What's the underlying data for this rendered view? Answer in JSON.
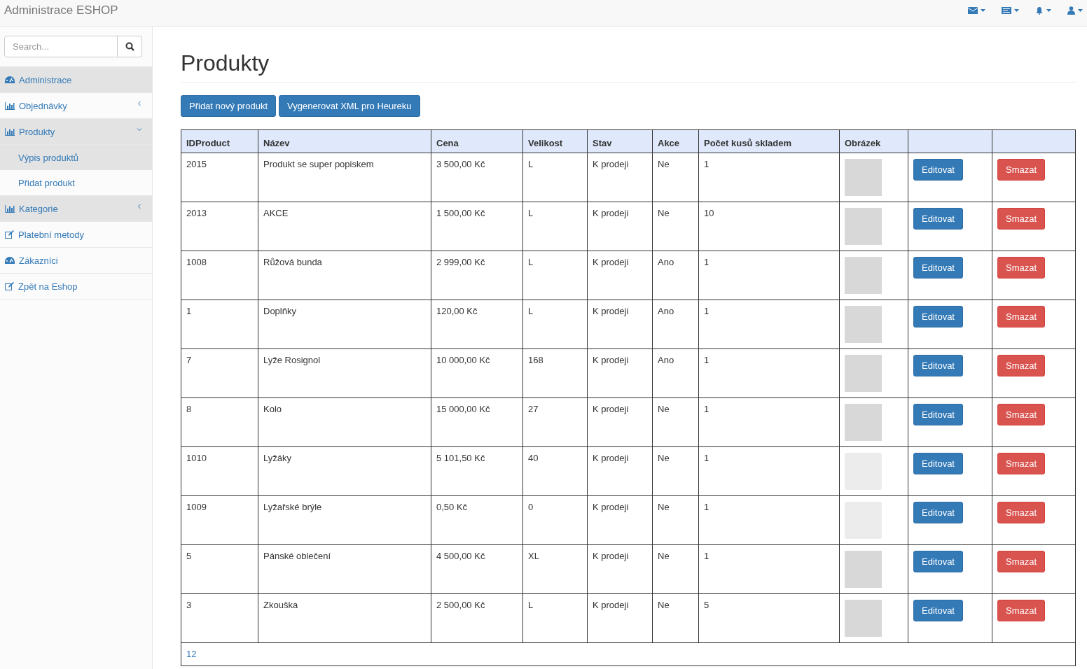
{
  "brand": "Administrace ESHOP",
  "topnav": [
    {
      "kind": "mail"
    },
    {
      "kind": "tasks"
    },
    {
      "kind": "bell"
    },
    {
      "kind": "user"
    }
  ],
  "search": {
    "placeholder": "Search..."
  },
  "sidebar": {
    "items": [
      {
        "label": "Administrace",
        "kind": "dashboard",
        "highlighted": true
      },
      {
        "label": "Objednávky",
        "kind": "chart",
        "highlighted": false,
        "expanded": false
      },
      {
        "label": "Produkty",
        "kind": "chart",
        "highlighted": true,
        "expanded": true,
        "children": [
          {
            "label": "Výpis produktů",
            "selected": true
          },
          {
            "label": "Přidat produkt",
            "selected": false
          }
        ]
      },
      {
        "label": "Kategorie",
        "kind": "chart",
        "highlighted": true,
        "expanded": false
      },
      {
        "label": "Platební metody",
        "kind": "edit",
        "highlighted": false
      },
      {
        "label": "Zákazníci",
        "kind": "dashboard",
        "highlighted": false
      },
      {
        "label": "Zpět na Eshop",
        "kind": "edit",
        "highlighted": false
      }
    ]
  },
  "page_title": "Produkty",
  "actions": [
    "Přidat nový produkt",
    "Vygenerovat XML pro Heureku"
  ],
  "table": {
    "columns": [
      "IDProduct",
      "Název",
      "Cena",
      "Velikost",
      "Stav",
      "Akce",
      "Počet kusů skladem",
      "Obrázek"
    ],
    "rows": [
      {
        "cells": [
          "2015",
          "Produkt se super popiskem",
          "3 500,00 Kč",
          "L",
          "K prodeji",
          "Ne",
          "1"
        ],
        "kind": "photo",
        "edit": "Editovat",
        "delete": "Smazat"
      },
      {
        "cells": [
          "2013",
          "AKCE",
          "1 500,00 Kč",
          "L",
          "K prodeji",
          "Ne",
          "10"
        ],
        "kind": "photo",
        "edit": "Editovat",
        "delete": "Smazat"
      },
      {
        "cells": [
          "1008",
          "Růžová bunda",
          "2 999,00 Kč",
          "L",
          "K prodeji",
          "Ano",
          "1"
        ],
        "kind": "photo",
        "edit": "Editovat",
        "delete": "Smazat"
      },
      {
        "cells": [
          "1",
          "Doplňky",
          "120,00 Kč",
          "L",
          "K prodeji",
          "Ano",
          "1"
        ],
        "kind": "photo",
        "edit": "Editovat",
        "delete": "Smazat"
      },
      {
        "cells": [
          "7",
          "Lyže Rosignol",
          "10 000,00 Kč",
          "168",
          "K prodeji",
          "Ano",
          "1"
        ],
        "kind": "photo",
        "edit": "Editovat",
        "delete": "Smazat"
      },
      {
        "cells": [
          "8",
          "Kolo",
          "15 000,00 Kč",
          "27",
          "K prodeji",
          "Ne",
          "1"
        ],
        "kind": "photo",
        "edit": "Editovat",
        "delete": "Smazat"
      },
      {
        "cells": [
          "1010",
          "Lyžáky",
          "5 101,50 Kč",
          "40",
          "K prodeji",
          "Ne",
          "1"
        ],
        "kind": "no_image",
        "edit": "Editovat",
        "delete": "Smazat"
      },
      {
        "cells": [
          "1009",
          "Lyžařské brýle",
          "0,50 Kč",
          "0",
          "K prodeji",
          "Ne",
          "1"
        ],
        "kind": "no_image",
        "edit": "Editovat",
        "delete": "Smazat"
      },
      {
        "cells": [
          "5",
          "Pánské oblečení",
          "4 500,00 Kč",
          "XL",
          "K prodeji",
          "Ne",
          "1"
        ],
        "kind": "photo",
        "edit": "Editovat",
        "delete": "Smazat"
      },
      {
        "cells": [
          "3",
          "Zkouška",
          "2 500,00 Kč",
          "L",
          "K prodeji",
          "Ne",
          "5"
        ],
        "kind": "photo",
        "edit": "Editovat",
        "delete": "Smazat"
      }
    ],
    "pagination": [
      "12"
    ]
  }
}
